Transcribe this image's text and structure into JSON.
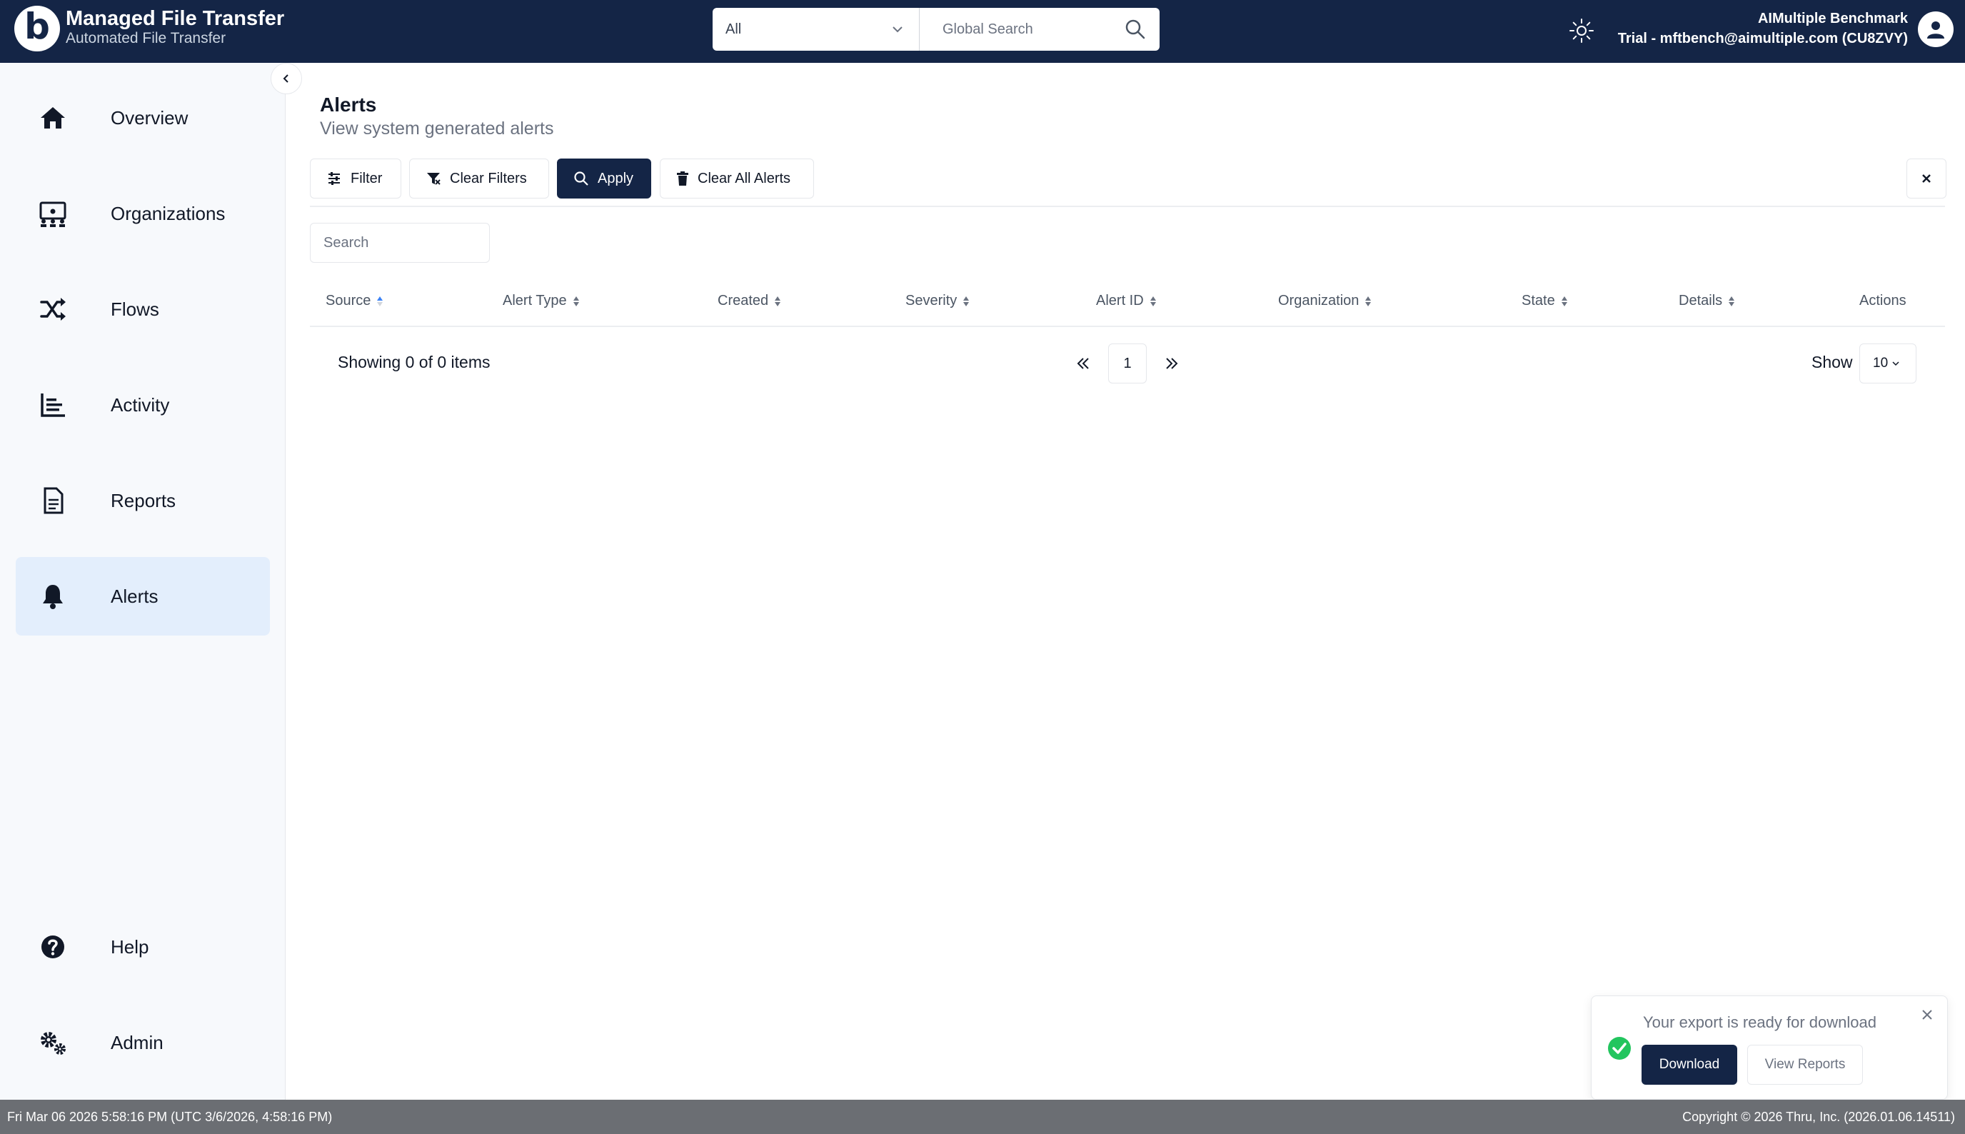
{
  "header": {
    "app_title": "Managed File Transfer",
    "app_subtitle": "Automated File Transfer",
    "logo_letter": "b",
    "search_scope": "All",
    "search_placeholder": "Global Search",
    "user_name": "AIMultiple Benchmark",
    "user_account": "Trial - mftbench@aimultiple.com (CU8ZVY)",
    "icons": [
      "chevron-down-icon",
      "search-icon",
      "sun-icon",
      "user-icon"
    ]
  },
  "sidebar": {
    "items": [
      {
        "label": "Overview",
        "icon": "home-icon",
        "active": false
      },
      {
        "label": "Organizations",
        "icon": "organization-icon",
        "active": false
      },
      {
        "label": "Flows",
        "icon": "shuffle-icon",
        "active": false
      },
      {
        "label": "Activity",
        "icon": "bar-list-icon",
        "active": false
      },
      {
        "label": "Reports",
        "icon": "document-icon",
        "active": false
      },
      {
        "label": "Alerts",
        "icon": "bell-icon",
        "active": true
      },
      {
        "label": "Help",
        "icon": "question-circle-icon",
        "active": false
      },
      {
        "label": "Admin",
        "icon": "gears-icon",
        "active": false
      }
    ]
  },
  "page": {
    "title": "Alerts",
    "subtitle": "View system generated alerts"
  },
  "toolbar": {
    "filter": "Filter",
    "clear_filters": "Clear Filters",
    "apply": "Apply",
    "clear_all": "Clear All Alerts"
  },
  "table": {
    "search_placeholder": "Search",
    "columns": [
      "Source",
      "Alert Type",
      "Created",
      "Severity",
      "Alert ID",
      "Organization",
      "State",
      "Details",
      "Actions"
    ],
    "sorted_column": "Source",
    "rows": []
  },
  "pagination": {
    "showing": "Showing 0 of 0 items",
    "current_page": "1",
    "show_label": "Show",
    "page_size": "10"
  },
  "toast": {
    "message": "Your export is ready for download",
    "download": "Download",
    "view_reports": "View Reports"
  },
  "footer": {
    "datetime": "Fri Mar 06 2026 5:58:16 PM (UTC 3/6/2026, 4:58:16 PM)",
    "copyright": "Copyright © 2026 Thru, Inc. (2026.01.06.14511)"
  },
  "colors": {
    "navy": "#142546",
    "active_nav_bg": "#e3eefc",
    "sidebar_bg": "#f7f9fc",
    "success": "#22c55e",
    "footer_bg": "#6b6e73"
  }
}
